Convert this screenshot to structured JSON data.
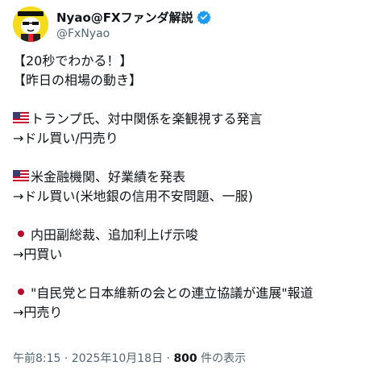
{
  "author": {
    "display_name": "Nyao@FXファンダ解説",
    "handle": "@FxNyao",
    "avatar_icon": "cat-avatar-icon",
    "verified_icon": "verified-badge-icon",
    "verified_color": "#1d9bf0"
  },
  "post": {
    "line1": "【20秒でわかる！】",
    "line2": "【昨日の相場の動き】",
    "item1_title": "トランプ氏、対中関係を楽観視する発言",
    "item1_effect": "→ドル買い/円売り",
    "item2_title": "米金融機関、好業績を発表",
    "item2_effect": "→ドル買い(米地銀の信用不安問題、一服)",
    "item3_title": "内田副総裁、追加利上げ示唆",
    "item3_effect": "→円買い",
    "item4_title": "\"自民党と日本維新の会との連立協議が進展\"報道",
    "item4_effect": "→円売り",
    "flag_us": "us-flag-icon",
    "flag_jp": "japan-flag-icon"
  },
  "footer": {
    "time": "午前8:15",
    "sep1": " · ",
    "date": "2025年10月18日",
    "sep2": " · ",
    "views_count": "800",
    "views_label": " 件の表示"
  }
}
